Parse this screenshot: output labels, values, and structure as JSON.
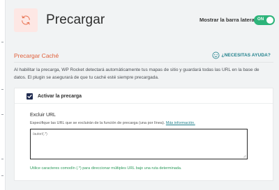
{
  "header": {
    "title": "Precargar",
    "sidebar_toggle_label": "Mostrar la barra lateral",
    "sidebar_toggle_state": "ON",
    "logo_icon": "refresh-icon"
  },
  "section": {
    "title": "Precargar Caché",
    "help_link": "¿NECESITAS AYUDA?",
    "help_icon": "help-face-icon",
    "intro": "Al habilitar la precarga, WP Rocket detectará automáticamente tus mapas de sitio y guardará todas las URL en la base de datos. El plugin se asegurará de que tu caché esté siempre precargada."
  },
  "preload": {
    "checkbox_label": "Activar la precarga",
    "checked": true,
    "exclude": {
      "title": "Excluir URL",
      "description": "Especifique las URL que se excluirán de la función de precarga (una por línea).",
      "more_link": "Más información.",
      "placeholder": "/autor/(.*)",
      "help": "Utilice caracteres comodín (.*) para direccionar múltiples URL bajo una ruta determinada."
    }
  },
  "colors": {
    "accent": "#e0603b",
    "toggle_on": "#2db47a",
    "link": "#1d7f8a",
    "help_text": "#2e9b5c",
    "checkbox": "#1f2b50"
  }
}
